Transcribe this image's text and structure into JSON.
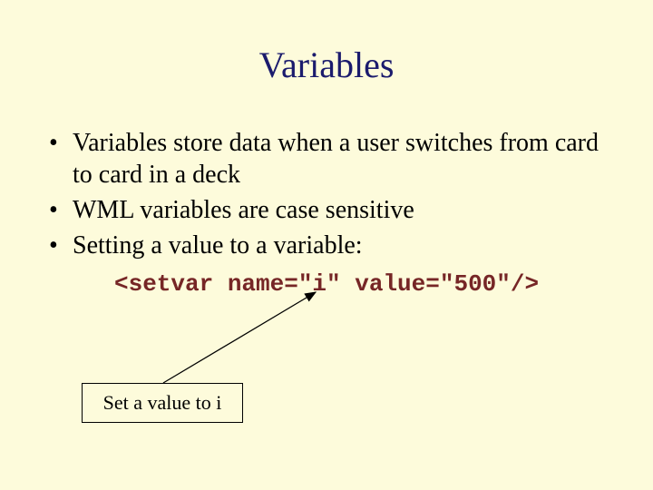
{
  "title": "Variables",
  "bullets": [
    "Variables store data when a user switches from card to card in a deck",
    "WML variables are case sensitive",
    "Setting a value to a variable:"
  ],
  "code": "<setvar name=\"i\" value=\"500\"/>",
  "callout": "Set a value to i"
}
